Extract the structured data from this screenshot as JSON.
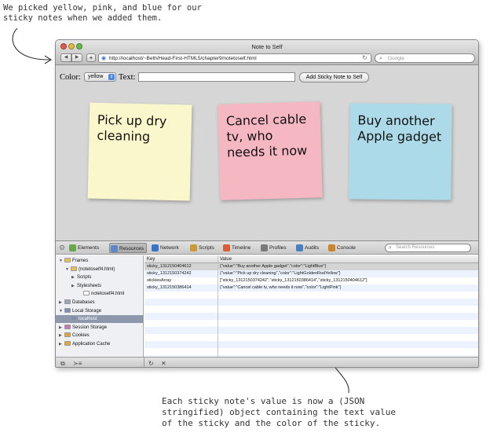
{
  "annotations": {
    "top": "We picked yellow, pink, and blue for our\nsticky notes when we added them.",
    "bottom": "Each sticky note's value is now a (JSON\nstringified) object containing the text value\nof the sticky and the color of the sticky."
  },
  "window": {
    "title": "Note to Self",
    "url": "http://localhost/~Beth/Head-First-HTML5/chapter9/notetoself.html",
    "search_placeholder": "Google"
  },
  "form": {
    "color_label": "Color:",
    "color_value": "yellow",
    "text_label": "Text:",
    "text_value": "",
    "add_button": "Add Sticky Note to Self"
  },
  "stickies": [
    {
      "text": "Pick up dry cleaning",
      "color": "#fbf7cc"
    },
    {
      "text": "Cancel cable tv, who needs it now",
      "color": "#f5b7c2"
    },
    {
      "text": "Buy another Apple gadget",
      "color": "#acdae8"
    }
  ],
  "devtools": {
    "tabs": [
      {
        "label": "Elements",
        "icon": "elements-icon",
        "color": "#69a84f"
      },
      {
        "label": "Resources",
        "icon": "resources-icon",
        "color": "#5f87c9"
      },
      {
        "label": "Network",
        "icon": "network-icon",
        "color": "#3b74c6"
      },
      {
        "label": "Scripts",
        "icon": "scripts-icon",
        "color": "#c89a3a"
      },
      {
        "label": "Timeline",
        "icon": "timeline-icon",
        "color": "#d95d3b"
      },
      {
        "label": "Profiles",
        "icon": "profiles-icon",
        "color": "#7a7a7a"
      },
      {
        "label": "Audits",
        "icon": "audits-icon",
        "color": "#4a7fc2"
      },
      {
        "label": "Console",
        "icon": "console-icon",
        "color": "#c8872a"
      }
    ],
    "search_placeholder": "Search Resources",
    "sidebar": [
      {
        "label": "Frames",
        "indent": 0,
        "tri": "▼",
        "icon": "folder-icon",
        "icolor": "#e9c24d"
      },
      {
        "label": "(notetoself4.html)",
        "indent": 1,
        "tri": "▼",
        "icon": "folder-icon",
        "icolor": "#e9c24d"
      },
      {
        "label": "Scripts",
        "indent": 2,
        "tri": "▶",
        "icon": "",
        "icolor": ""
      },
      {
        "label": "Stylesheets",
        "indent": 2,
        "tri": "▶",
        "icon": "",
        "icolor": ""
      },
      {
        "label": "notetoself4.html",
        "indent": 3,
        "tri": "",
        "icon": "file-icon",
        "icolor": "#ffffff"
      },
      {
        "label": "Databases",
        "indent": 0,
        "tri": "▶",
        "icon": "database-icon",
        "icolor": "#9aa4b3"
      },
      {
        "label": "Local Storage",
        "indent": 0,
        "tri": "▼",
        "icon": "storage-icon",
        "icolor": "#7d8fb5"
      },
      {
        "label": "localhost",
        "indent": 1,
        "tri": "",
        "icon": "storage-icon",
        "icolor": "#7d8fb5",
        "selected": true
      },
      {
        "label": "Session Storage",
        "indent": 0,
        "tri": "▶",
        "icon": "storage-icon",
        "icolor": "#c57ab4"
      },
      {
        "label": "Cookies",
        "indent": 0,
        "tri": "▶",
        "icon": "cookie-icon",
        "icolor": "#e0a63c"
      },
      {
        "label": "Application Cache",
        "indent": 0,
        "tri": "▶",
        "icon": "cache-icon",
        "icolor": "#e0a63c"
      }
    ],
    "grid": {
      "headers": {
        "key": "Key",
        "value": "Value"
      },
      "rows": [
        {
          "key": "sticky_1312150404612",
          "value": "{\"value\":\"Buy another Apple gadget\",\"color\":\"LightBlue\"}",
          "selected": true
        },
        {
          "key": "sticky_1312150374242",
          "value": "{\"value\":\"Pick up dry cleaning\",\"color\":\"LightGoldenRodYellow\"}"
        },
        {
          "key": "stickiesArray",
          "value": "[\"sticky_1312150374242\",\"sticky_1312150386414\",\"sticky_1312150404612\"]"
        },
        {
          "key": "sticky_1312150386414",
          "value": "{\"value\":\"Cancel cable tv, who needs it now\",\"color\":\"LightPink\"}"
        }
      ]
    }
  }
}
